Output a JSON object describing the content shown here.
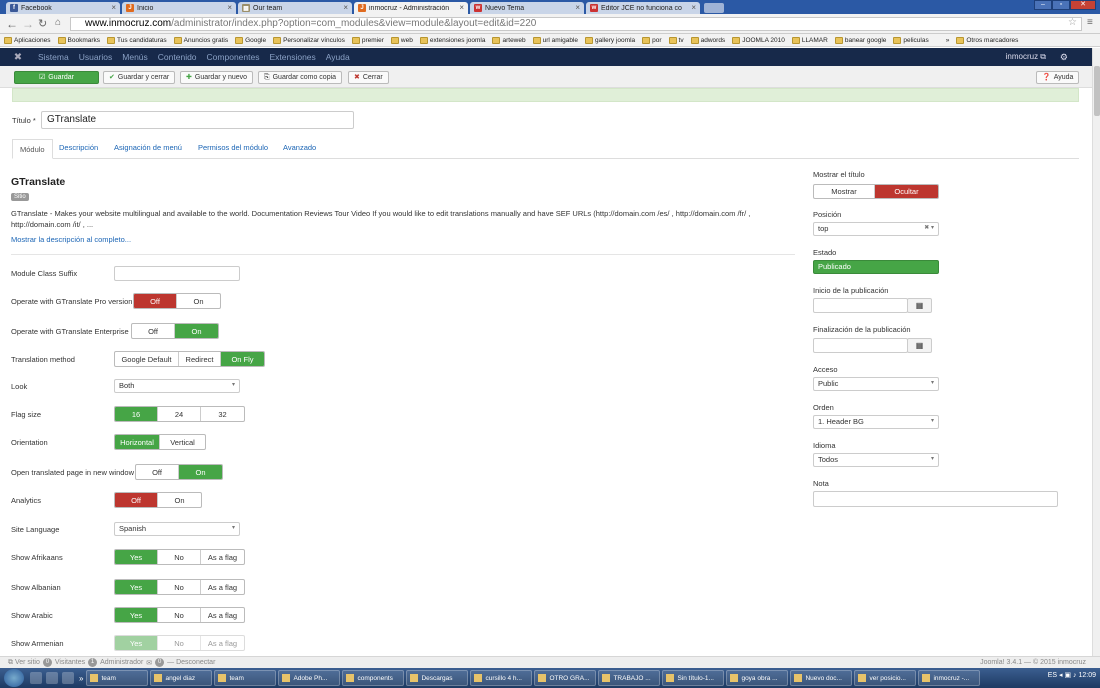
{
  "browser": {
    "tabs": [
      {
        "title": "Facebook",
        "fav_color": "#3b5998",
        "fav_letter": "f"
      },
      {
        "title": "Inicio",
        "fav_color": "#e06b1f",
        "fav_letter": "J"
      },
      {
        "title": "Our team",
        "fav_color": "#9b8f6a",
        "fav_letter": "▦"
      },
      {
        "title": "inmocruz - Administración",
        "fav_color": "#e06b1f",
        "fav_letter": "J",
        "active": true
      },
      {
        "title": "Nuevo Tema",
        "fav_color": "#c33",
        "fav_letter": "w"
      },
      {
        "title": "Editor JCE no funciona co",
        "fav_color": "#c33",
        "fav_letter": "w"
      }
    ],
    "url_host": "www.inmocruz.com",
    "url_rest": "/administrator/index.php?option=com_modules&view=module&layout=edit&id=220",
    "bookmarks": [
      "Aplicaciones",
      "Bookmarks",
      "Tus candidaturas",
      "Anuncios gratis",
      "Google",
      "Personalizar vínculos",
      "premier",
      "web",
      "extensiones joomla",
      "arteweb",
      "url amigable",
      "gallery joomla",
      "por",
      "tv",
      "adwords",
      "JOOMLA 2010",
      "LLAMAR",
      "banear google",
      "peliculas"
    ],
    "bookmarks_more": "»",
    "other_bookmarks": "Otros marcadores"
  },
  "admin_menu": {
    "items": [
      "Sistema",
      "Usuarios",
      "Menús",
      "Contenido",
      "Componentes",
      "Extensiones",
      "Ayuda"
    ],
    "site": "inmocruz",
    "site_icon": "external-link-icon"
  },
  "toolbar": {
    "save": "Guardar",
    "save_close": "Guardar y cerrar",
    "save_new": "Guardar y nuevo",
    "save_copy": "Guardar como copia",
    "close": "Cerrar",
    "help": "Ayuda"
  },
  "form": {
    "title_label": "Título *",
    "title_value": "GTranslate",
    "tabs": [
      "Módulo",
      "Descripción",
      "Asignación de menú",
      "Permisos del módulo",
      "Avanzado"
    ],
    "module_name": "GTranslate",
    "badge": "Sitio",
    "description": "GTranslate - Makes your website multilingual and available to the world. Documentation Reviews Tour Video If you would like to edit translations manually and have SEF URLs (http://domain.com /es/ , http://domain.com /fr/ , http://domain.com /it/ , ...",
    "show_full": "Mostrar la descripción al completo...",
    "fields": [
      {
        "label": "Module Class Suffix",
        "type": "text",
        "value": ""
      },
      {
        "label": "Operate with GTranslate Pro version",
        "type": "seg",
        "options": [
          "Off",
          "On"
        ],
        "selected": "Off"
      },
      {
        "label": "Operate with GTranslate Enterprise",
        "type": "seg",
        "options": [
          "Off",
          "On"
        ],
        "selected": "On"
      },
      {
        "label": "Translation method",
        "type": "seg",
        "options": [
          "Google Default",
          "Redirect",
          "On Fly"
        ],
        "selected": "On Fly"
      },
      {
        "label": "Look",
        "type": "select",
        "value": "Both"
      },
      {
        "label": "Flag size",
        "type": "seg",
        "options": [
          "16",
          "24",
          "32"
        ],
        "selected": "16"
      },
      {
        "label": "Orientation",
        "type": "seg",
        "options": [
          "Horizontal",
          "Vertical"
        ],
        "selected": "Horizontal"
      },
      {
        "label": "Open translated page in new window",
        "type": "seg",
        "options": [
          "Off",
          "On"
        ],
        "selected": "On"
      },
      {
        "label": "Analytics",
        "type": "seg",
        "options": [
          "Off",
          "On"
        ],
        "selected": "Off"
      },
      {
        "label": "Site Language",
        "type": "select",
        "value": "Spanish"
      },
      {
        "label": "Show Afrikaans",
        "type": "seg",
        "options": [
          "Yes",
          "No",
          "As a flag"
        ],
        "selected": "Yes"
      },
      {
        "label": "Show Albanian",
        "type": "seg",
        "options": [
          "Yes",
          "No",
          "As a flag"
        ],
        "selected": "Yes"
      },
      {
        "label": "Show Arabic",
        "type": "seg",
        "options": [
          "Yes",
          "No",
          "As a flag"
        ],
        "selected": "Yes"
      },
      {
        "label": "Show Armenian",
        "type": "seg",
        "options": [
          "Yes",
          "No",
          "As a flag"
        ],
        "selected": "Yes"
      }
    ]
  },
  "sidebar": {
    "show_title_label": "Mostrar el título",
    "show_title_options": [
      "Mostrar",
      "Ocultar"
    ],
    "show_title_selected": "Ocultar",
    "position_label": "Posición",
    "position_value": "top",
    "status_label": "Estado",
    "status_value": "Publicado",
    "publish_up_label": "Inicio de la publicación",
    "publish_down_label": "Finalización de la publicación",
    "access_label": "Acceso",
    "access_value": "Public",
    "order_label": "Orden",
    "order_value": "1. Header BG",
    "language_label": "Idioma",
    "language_value": "Todos",
    "note_label": "Nota"
  },
  "status": {
    "view_site": "Ver sitio",
    "visitors_count": "0",
    "visitors": "Visitantes",
    "admin_count": "1",
    "admin": "Administrador",
    "messages_count": "0",
    "logout": "Desconectar",
    "version": "Joomla! 3.4.1 — © 2015 inmocruz"
  },
  "taskbar": {
    "items": [
      "team",
      "angel diaz",
      "team",
      "Adobe Ph...",
      "components",
      "Descargas",
      "cursillo 4 h...",
      "OTRO GRA...",
      "TRABAJO ...",
      "Sin título-1...",
      "goya obra ...",
      "Nuevo doc...",
      "ver posicio...",
      "inmocruz -..."
    ],
    "lang": "ES",
    "time": "12:09"
  }
}
